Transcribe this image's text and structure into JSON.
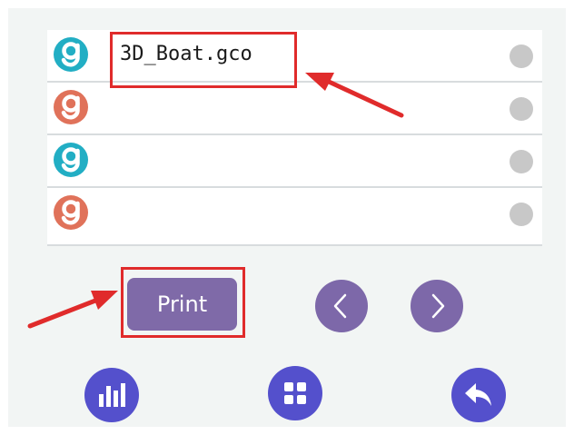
{
  "files": [
    {
      "name": "3D_Boat.gco",
      "icon": "gcode-file-icon",
      "color": "#22aec4"
    },
    {
      "name": "",
      "icon": "gcode-file-icon",
      "color": "#e0725a"
    },
    {
      "name": "",
      "icon": "gcode-file-icon",
      "color": "#22aec4"
    },
    {
      "name": "",
      "icon": "gcode-file-icon",
      "color": "#e0725a"
    }
  ],
  "controls": {
    "print_label": "Print",
    "prev_icon": "chevron-left-icon",
    "next_icon": "chevron-right-icon"
  },
  "bottom_nav": [
    {
      "icon": "bar-chart-icon"
    },
    {
      "icon": "grid-icon"
    },
    {
      "icon": "back-icon"
    }
  ],
  "colors": {
    "accent": "#7f6aa8",
    "nav_accent": "#5450cc",
    "annotation": "#e02b2b"
  }
}
